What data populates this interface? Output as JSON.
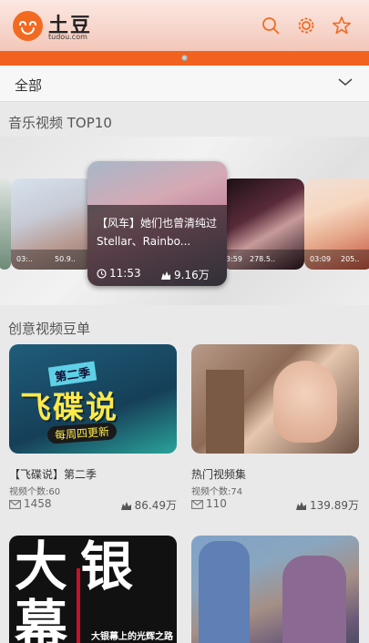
{
  "header": {
    "logo_name": "土豆",
    "logo_domain": "tudou.com",
    "icons": [
      "search-icon",
      "settings-icon",
      "star-icon"
    ],
    "accent": "#f26a21"
  },
  "filter": {
    "label": "全部"
  },
  "music": {
    "title": "音乐视频 TOP10",
    "featured": {
      "title": "【风车】她们也曾清纯过 Stellar、Rainbo...",
      "duration": "11:53",
      "views": "9.16万"
    },
    "side_items": [
      {
        "duration": "03:..",
        "views": "50.9.."
      },
      {
        "duration": "3:59",
        "views": "278.5.."
      },
      {
        "duration": "03:09",
        "views": "205.."
      }
    ]
  },
  "creative": {
    "title": "创意视频豆单",
    "cards": [
      {
        "title": "【飞碟说】第二季",
        "count": "视频个数:60",
        "comments": "1458",
        "views": "86.49万",
        "thumb_text_top": "第二季",
        "thumb_text_main": "飞碟说",
        "thumb_text_bottom": "每周四更新"
      },
      {
        "title": "热门视频集",
        "count": "视频个数:74",
        "comments": "110",
        "views": "139.89万"
      },
      {
        "thumb_text_main": "大银幕",
        "thumb_caption": "大银幕上的光辉之路"
      },
      {}
    ]
  }
}
